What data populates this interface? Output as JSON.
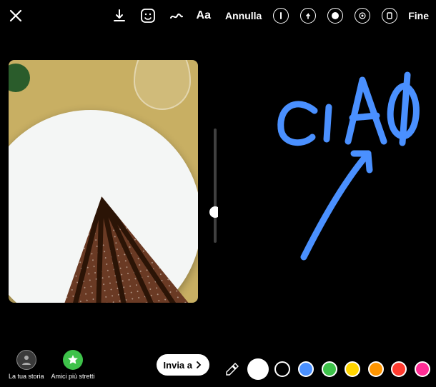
{
  "leftTop": {},
  "rightTop": {
    "cancel": "Annulla",
    "done": "Fine"
  },
  "textTool": "Aa",
  "photo": {
    "alt": "cake-on-plate"
  },
  "slider": {
    "thumbPercent": 68
  },
  "destinations": {
    "story": "La tua storia",
    "closeFriends": "Amici più stretti"
  },
  "send": {
    "label": "Invia a"
  },
  "drawing": {
    "text": "CiAO"
  },
  "palette": {
    "colors": [
      "#ffffff",
      "#000000",
      "#4a90ff",
      "#3ec24a",
      "#ffd400",
      "#ff9500",
      "#ff3b30",
      "#ff2d95"
    ],
    "selectedIndex": 0
  }
}
